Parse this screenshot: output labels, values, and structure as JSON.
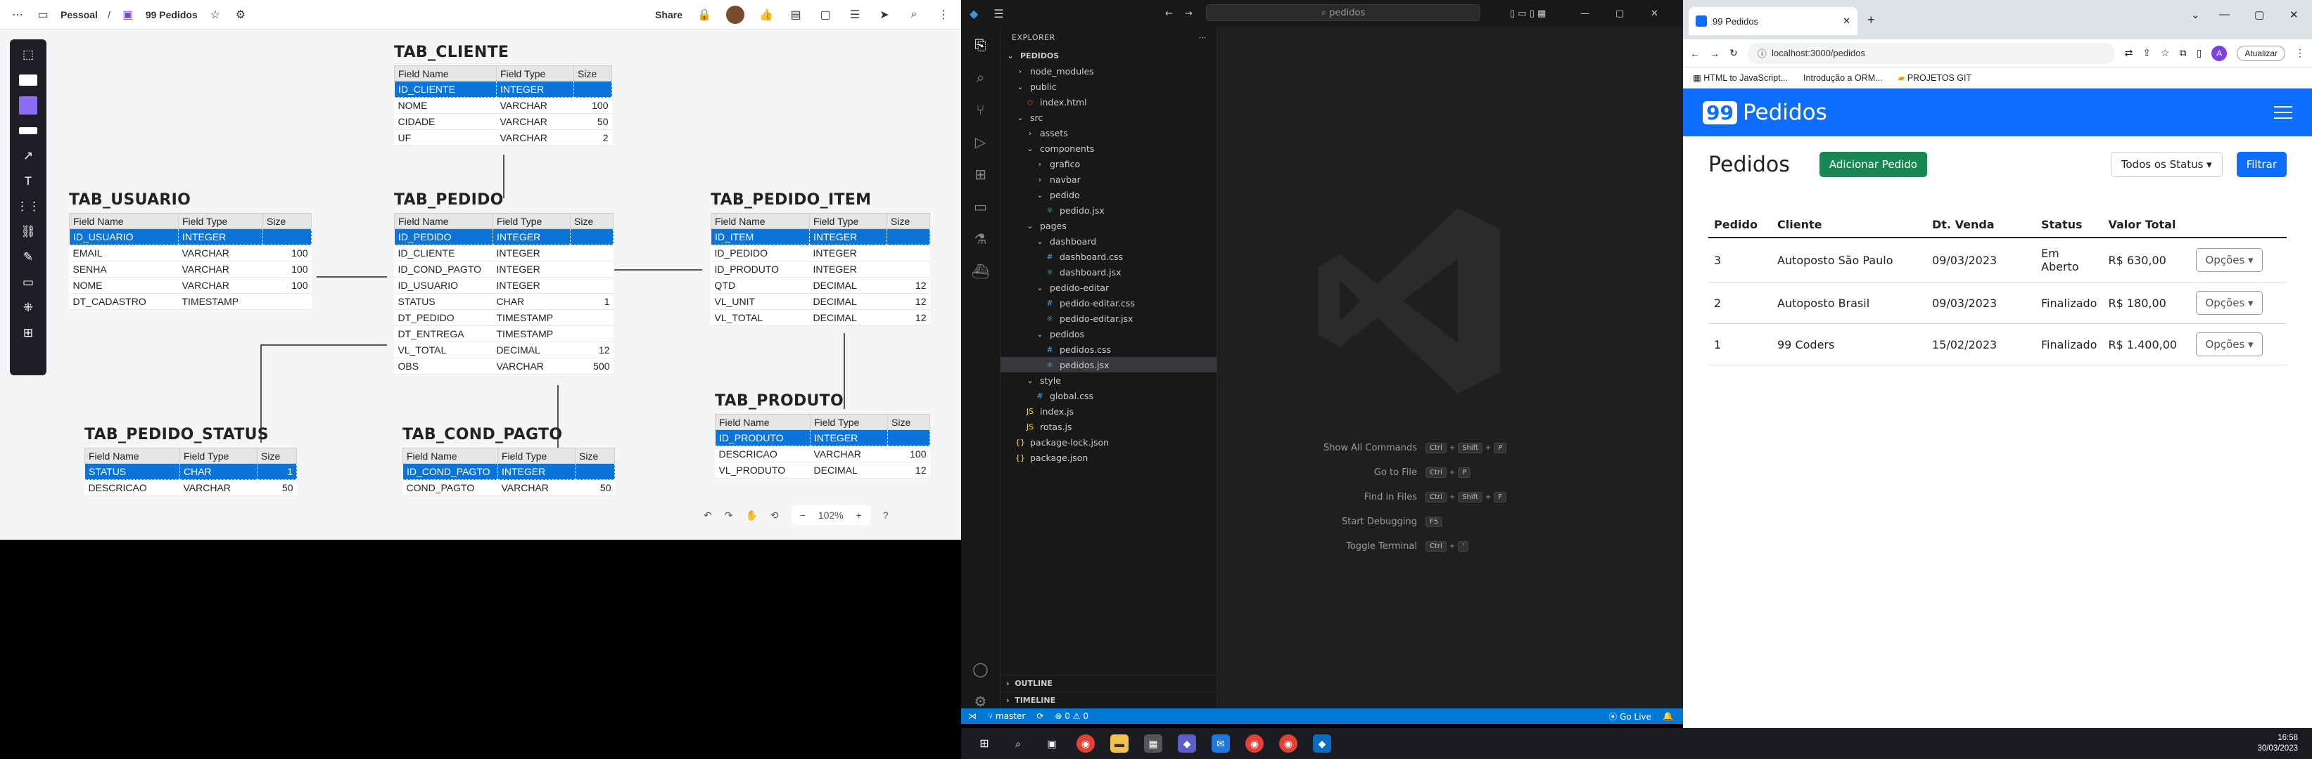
{
  "whiteboard": {
    "breadcrumb": {
      "space": "Pessoal",
      "board": "99 Pedidos"
    },
    "share_label": "Share",
    "zoom": "102%",
    "help": "?",
    "tables": {
      "cliente": {
        "name": "TAB_CLIENTE",
        "headers": [
          "Field Name",
          "Field Type",
          "Size"
        ],
        "rows": [
          [
            "ID_CLIENTE",
            "INTEGER",
            ""
          ],
          [
            "NOME",
            "VARCHAR",
            "100"
          ],
          [
            "CIDADE",
            "VARCHAR",
            "50"
          ],
          [
            "UF",
            "VARCHAR",
            "2"
          ]
        ]
      },
      "usuario": {
        "name": "TAB_USUARIO",
        "headers": [
          "Field Name",
          "Field Type",
          "Size"
        ],
        "rows": [
          [
            "ID_USUARIO",
            "INTEGER",
            ""
          ],
          [
            "EMAIL",
            "VARCHAR",
            "100"
          ],
          [
            "SENHA",
            "VARCHAR",
            "100"
          ],
          [
            "NOME",
            "VARCHAR",
            "100"
          ],
          [
            "DT_CADASTRO",
            "TIMESTAMP",
            ""
          ]
        ]
      },
      "pedido": {
        "name": "TAB_PEDIDO",
        "headers": [
          "Field Name",
          "Field Type",
          "Size"
        ],
        "rows": [
          [
            "ID_PEDIDO",
            "INTEGER",
            ""
          ],
          [
            "ID_CLIENTE",
            "INTEGER",
            ""
          ],
          [
            "ID_COND_PAGTO",
            "INTEGER",
            ""
          ],
          [
            "ID_USUARIO",
            "INTEGER",
            ""
          ],
          [
            "STATUS",
            "CHAR",
            "1"
          ],
          [
            "DT_PEDIDO",
            "TIMESTAMP",
            ""
          ],
          [
            "DT_ENTREGA",
            "TIMESTAMP",
            ""
          ],
          [
            "VL_TOTAL",
            "DECIMAL",
            "12"
          ],
          [
            "OBS",
            "VARCHAR",
            "500"
          ]
        ]
      },
      "pedido_item": {
        "name": "TAB_PEDIDO_ITEM",
        "headers": [
          "Field Name",
          "Field Type",
          "Size"
        ],
        "rows": [
          [
            "ID_ITEM",
            "INTEGER",
            ""
          ],
          [
            "ID_PEDIDO",
            "INTEGER",
            ""
          ],
          [
            "ID_PRODUTO",
            "INTEGER",
            ""
          ],
          [
            "QTD",
            "DECIMAL",
            "12"
          ],
          [
            "VL_UNIT",
            "DECIMAL",
            "12"
          ],
          [
            "VL_TOTAL",
            "DECIMAL",
            "12"
          ]
        ]
      },
      "pedido_status": {
        "name": "TAB_PEDIDO_STATUS",
        "headers": [
          "Field Name",
          "Field Type",
          "Size"
        ],
        "rows": [
          [
            "STATUS",
            "CHAR",
            "1"
          ],
          [
            "DESCRICAO",
            "VARCHAR",
            "50"
          ]
        ]
      },
      "cond_pagto": {
        "name": "TAB_COND_PAGTO",
        "headers": [
          "Field Name",
          "Field Type",
          "Size"
        ],
        "rows": [
          [
            "ID_COND_PAGTO",
            "INTEGER",
            ""
          ],
          [
            "COND_PAGTO",
            "VARCHAR",
            "50"
          ]
        ]
      },
      "produto": {
        "name": "TAB_PRODUTO",
        "headers": [
          "Field Name",
          "Field Type",
          "Size"
        ],
        "rows": [
          [
            "ID_PRODUTO",
            "INTEGER",
            ""
          ],
          [
            "DESCRICAO",
            "VARCHAR",
            "100"
          ],
          [
            "VL_PRODUTO",
            "DECIMAL",
            "12"
          ]
        ]
      }
    }
  },
  "vscode": {
    "search": "pedidos",
    "explorer_title": "EXPLORER",
    "root": "PEDIDOS",
    "tree": [
      {
        "label": "node_modules",
        "kind": "folder",
        "depth": 1,
        "open": false
      },
      {
        "label": "public",
        "kind": "folder",
        "depth": 1,
        "open": true
      },
      {
        "label": "index.html",
        "kind": "html",
        "depth": 2
      },
      {
        "label": "src",
        "kind": "folder",
        "depth": 1,
        "open": true
      },
      {
        "label": "assets",
        "kind": "folder",
        "depth": 2,
        "open": false
      },
      {
        "label": "components",
        "kind": "folder",
        "depth": 2,
        "open": true
      },
      {
        "label": "grafico",
        "kind": "folder",
        "depth": 3,
        "open": false
      },
      {
        "label": "navbar",
        "kind": "folder",
        "depth": 3,
        "open": false
      },
      {
        "label": "pedido",
        "kind": "folder",
        "depth": 3,
        "open": true
      },
      {
        "label": "pedido.jsx",
        "kind": "jsx",
        "depth": 4
      },
      {
        "label": "pages",
        "kind": "folder",
        "depth": 2,
        "open": true
      },
      {
        "label": "dashboard",
        "kind": "folder",
        "depth": 3,
        "open": true
      },
      {
        "label": "dashboard.css",
        "kind": "css",
        "depth": 4
      },
      {
        "label": "dashboard.jsx",
        "kind": "jsx",
        "depth": 4
      },
      {
        "label": "pedido-editar",
        "kind": "folder",
        "depth": 3,
        "open": true
      },
      {
        "label": "pedido-editar.css",
        "kind": "css",
        "depth": 4
      },
      {
        "label": "pedido-editar.jsx",
        "kind": "jsx",
        "depth": 4
      },
      {
        "label": "pedidos",
        "kind": "folder",
        "depth": 3,
        "open": true
      },
      {
        "label": "pedidos.css",
        "kind": "css",
        "depth": 4
      },
      {
        "label": "pedidos.jsx",
        "kind": "jsx",
        "depth": 4,
        "selected": true
      },
      {
        "label": "style",
        "kind": "folder",
        "depth": 2,
        "open": true
      },
      {
        "label": "global.css",
        "kind": "css",
        "depth": 3
      },
      {
        "label": "index.js",
        "kind": "js",
        "depth": 2
      },
      {
        "label": "rotas.js",
        "kind": "js",
        "depth": 2
      },
      {
        "label": "package-lock.json",
        "kind": "json",
        "depth": 1
      },
      {
        "label": "package.json",
        "kind": "json",
        "depth": 1
      }
    ],
    "outline": "OUTLINE",
    "timeline": "TIMELINE",
    "hints": [
      {
        "label": "Show All Commands",
        "keys": [
          "Ctrl",
          "+",
          "Shift",
          "+",
          "P"
        ]
      },
      {
        "label": "Go to File",
        "keys": [
          "Ctrl",
          "+",
          "P"
        ]
      },
      {
        "label": "Find in Files",
        "keys": [
          "Ctrl",
          "+",
          "Shift",
          "+",
          "F"
        ]
      },
      {
        "label": "Start Debugging",
        "keys": [
          "F5"
        ]
      },
      {
        "label": "Toggle Terminal",
        "keys": [
          "Ctrl",
          "+",
          "'"
        ]
      }
    ],
    "status": {
      "branch": "master",
      "problems": "0",
      "warnings": "0",
      "golive": "Go Live"
    }
  },
  "browser": {
    "tab_title": "99 Pedidos",
    "url": "localhost:3000/pedidos",
    "update_label": "Atualizar",
    "bookmarks": [
      "HTML to JavaScript...",
      "Introdução a ORM...",
      "PROJETOS GIT"
    ],
    "brand_box": "99",
    "brand_text": "Pedidos",
    "page_title": "Pedidos",
    "add_label": "Adicionar Pedido",
    "status_filter": "Todos os Status",
    "filter_label": "Filtrar",
    "columns": [
      "Pedido",
      "Cliente",
      "Dt. Venda",
      "Status",
      "Valor Total"
    ],
    "rows": [
      {
        "id": "3",
        "cliente": "Autoposto São Paulo",
        "data": "09/03/2023",
        "status": "Em Aberto",
        "valor": "R$ 630,00"
      },
      {
        "id": "2",
        "cliente": "Autoposto Brasil",
        "data": "09/03/2023",
        "status": "Finalizado",
        "valor": "R$ 180,00"
      },
      {
        "id": "1",
        "cliente": "99 Coders",
        "data": "15/02/2023",
        "status": "Finalizado",
        "valor": "R$ 1.400,00"
      }
    ],
    "options_label": "Opções"
  },
  "taskbar": {
    "time": "16:58",
    "date": "30/03/2023"
  }
}
